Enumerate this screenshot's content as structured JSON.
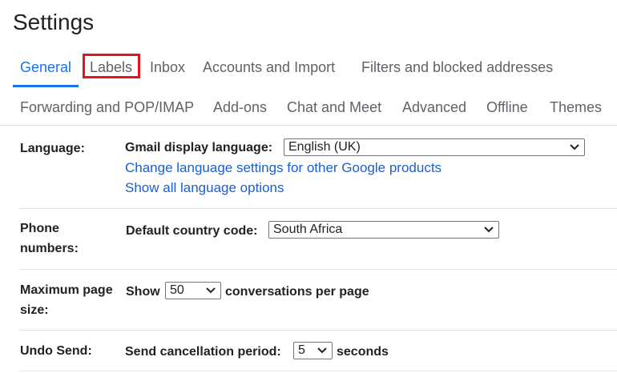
{
  "page": {
    "title": "Settings"
  },
  "tabs_row1": [
    {
      "label": "General"
    },
    {
      "label": "Labels"
    },
    {
      "label": "Inbox"
    },
    {
      "label": "Accounts and Import"
    },
    {
      "label": "Filters and blocked addresses"
    }
  ],
  "tabs_row2": [
    {
      "label": "Forwarding and POP/IMAP"
    },
    {
      "label": "Add-ons"
    },
    {
      "label": "Chat and Meet"
    },
    {
      "label": "Advanced"
    },
    {
      "label": "Offline"
    },
    {
      "label": "Themes"
    }
  ],
  "language": {
    "label": "Language:",
    "display_label": "Gmail display language:",
    "selected": "English (UK)",
    "link1": "Change language settings for other Google products",
    "link2": "Show all language options"
  },
  "phone": {
    "label_line1": "Phone",
    "label_line2": "numbers:",
    "country_label": "Default country code:",
    "selected": "South Africa"
  },
  "page_size": {
    "label_line1": "Maximum page",
    "label_line2": "size:",
    "show_label": "Show",
    "selected": "50",
    "suffix": "conversations per page"
  },
  "undo_send": {
    "label": "Undo Send:",
    "period_label": "Send cancellation period:",
    "selected": "5",
    "suffix": "seconds"
  },
  "colors": {
    "active_tab": "#1a73e8",
    "link": "#1a5fd0",
    "highlight": "#e4141e"
  },
  "icons": {
    "dropdown": "chevron-down-icon"
  }
}
